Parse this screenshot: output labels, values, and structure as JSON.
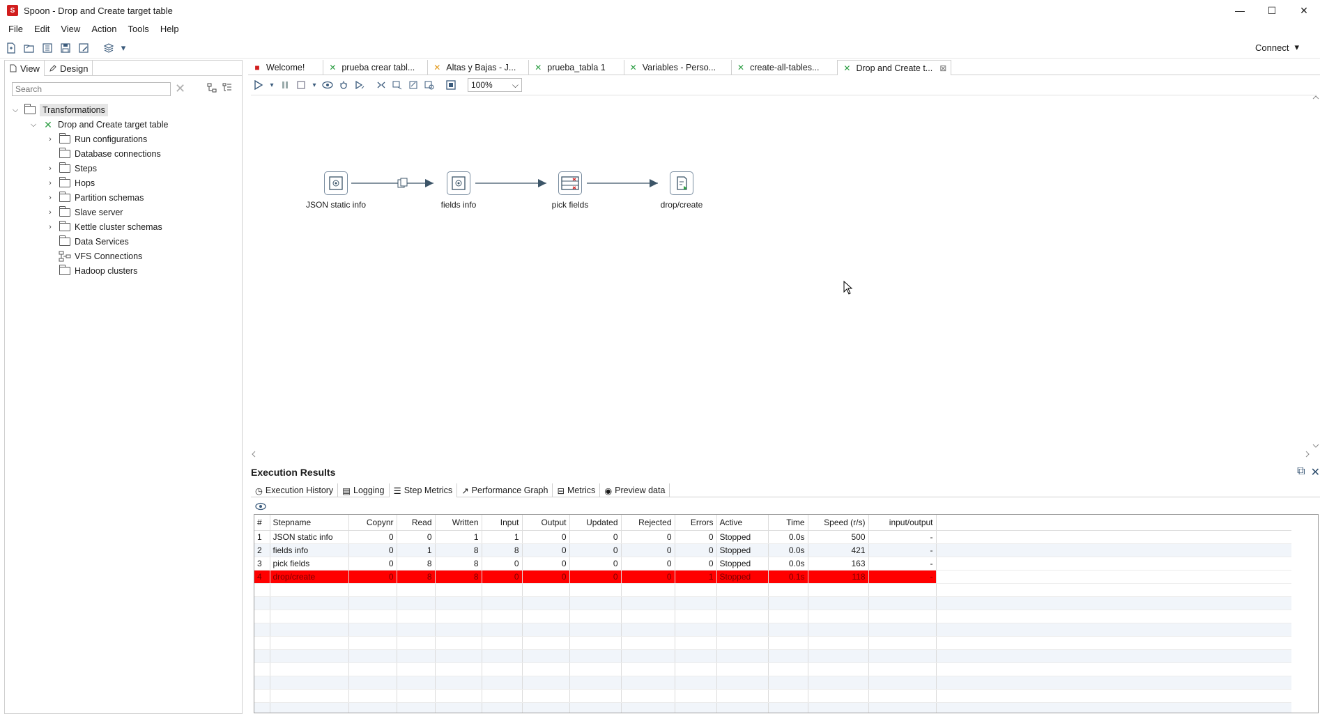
{
  "window": {
    "title": "Spoon - Drop and Create target table",
    "minimize": "—",
    "maximize": "☐",
    "close": "✕"
  },
  "menu": [
    "File",
    "Edit",
    "View",
    "Action",
    "Tools",
    "Help"
  ],
  "toolbar": {
    "connect_label": "Connect"
  },
  "left_panel": {
    "tabs": [
      "View",
      "Design"
    ],
    "search_placeholder": "Search",
    "tree": {
      "root": "Transformations",
      "transformation": "Drop and Create target table",
      "children": [
        "Run configurations",
        "Database connections",
        "Steps",
        "Hops",
        "Partition schemas",
        "Slave server",
        "Kettle cluster schemas",
        "Data Services",
        "VFS Connections",
        "Hadoop clusters"
      ]
    }
  },
  "doc_tabs": [
    "Welcome!",
    "prueba crear tabl...",
    "Altas y Bajas - J...",
    "prueba_tabla 1",
    "Variables - Perso...",
    "create-all-tables...",
    "Drop and Create t..."
  ],
  "canvas_toolbar": {
    "zoom": "100%"
  },
  "canvas": {
    "steps": [
      "JSON static info",
      "fields info",
      "pick fields",
      "drop/create"
    ]
  },
  "execution_results": {
    "title": "Execution Results",
    "tabs": [
      "Execution History",
      "Logging",
      "Step Metrics",
      "Performance Graph",
      "Metrics",
      "Preview data"
    ],
    "columns": [
      "#",
      "Stepname",
      "Copynr",
      "Read",
      "Written",
      "Input",
      "Output",
      "Updated",
      "Rejected",
      "Errors",
      "Active",
      "Time",
      "Speed (r/s)",
      "input/output"
    ],
    "rows": [
      [
        "1",
        "JSON static info",
        "0",
        "0",
        "1",
        "1",
        "0",
        "0",
        "0",
        "0",
        "Stopped",
        "0.0s",
        "500",
        "-"
      ],
      [
        "2",
        "fields info",
        "0",
        "1",
        "8",
        "8",
        "0",
        "0",
        "0",
        "0",
        "Stopped",
        "0.0s",
        "421",
        "-"
      ],
      [
        "3",
        "pick fields",
        "0",
        "8",
        "8",
        "0",
        "0",
        "0",
        "0",
        "0",
        "Stopped",
        "0.0s",
        "163",
        "-"
      ],
      [
        "4",
        "drop/create",
        "0",
        "8",
        "8",
        "0",
        "0",
        "0",
        "0",
        "1",
        "Stopped",
        "0.1s",
        "118",
        "-"
      ]
    ]
  },
  "colors": {
    "error_row": "#ff0000",
    "transformation_icon": "#2e9e45",
    "app_icon": "#d11d1d"
  }
}
